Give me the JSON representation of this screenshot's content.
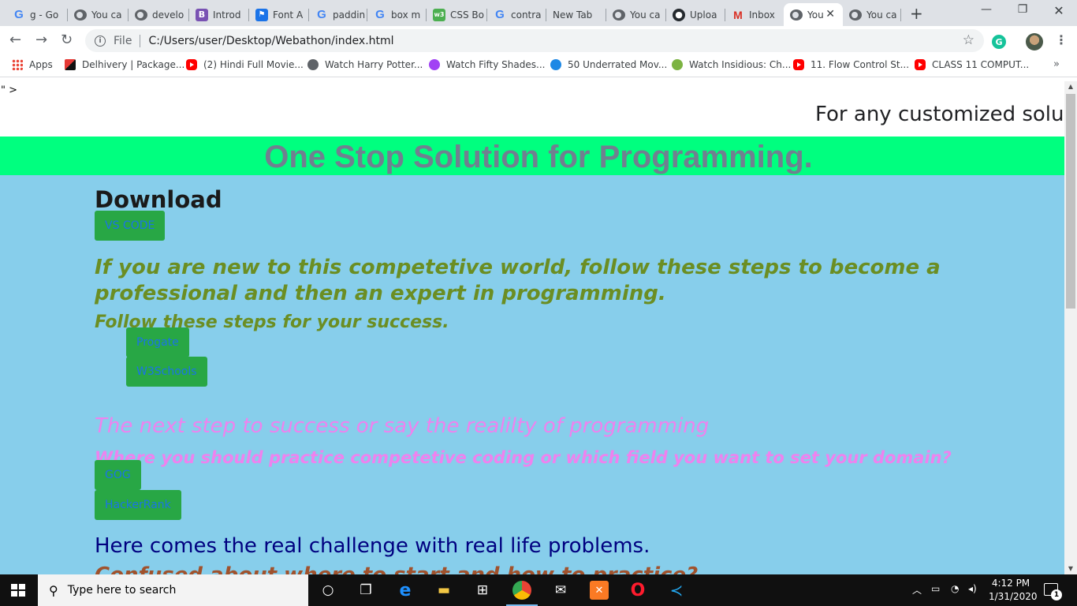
{
  "tabs": [
    {
      "label": "g - Go",
      "icon": "google-icon"
    },
    {
      "label": "You ca",
      "icon": "globe-icon"
    },
    {
      "label": "develo",
      "icon": "globe-icon"
    },
    {
      "label": "Introd",
      "icon": "bootstrap-icon"
    },
    {
      "label": "Font A",
      "icon": "flag-icon"
    },
    {
      "label": "paddin",
      "icon": "google-icon"
    },
    {
      "label": "box m",
      "icon": "google-icon"
    },
    {
      "label": "CSS Bo",
      "icon": "w3schools-icon"
    },
    {
      "label": "contra",
      "icon": "google-icon"
    },
    {
      "label": "New Tab",
      "icon": ""
    },
    {
      "label": "You ca",
      "icon": "globe-icon"
    },
    {
      "label": "Uploa",
      "icon": "github-icon"
    },
    {
      "label": "Inbox",
      "icon": "gmail-icon"
    },
    {
      "label": "You",
      "icon": "globe-icon",
      "active": true
    },
    {
      "label": "You ca",
      "icon": "globe-icon"
    }
  ],
  "toolbar": {
    "scheme": "File",
    "url": "C:/Users/user/Desktop/Webathon/index.html",
    "extension_letter": "G"
  },
  "bookmarks": [
    {
      "label": "Apps",
      "icon": "apps-icon"
    },
    {
      "label": "Delhivery | Package...",
      "icon": "delhivery-icon"
    },
    {
      "label": "(2) Hindi Full Movie...",
      "icon": "youtube-icon"
    },
    {
      "label": "Watch Harry Potter...",
      "icon": "globe-icon"
    },
    {
      "label": "Watch Fifty Shades...",
      "icon": "play-icon"
    },
    {
      "label": "50 Underrated Mov...",
      "icon": "sw-icon"
    },
    {
      "label": "Watch Insidious: Ch...",
      "icon": "play-icon"
    },
    {
      "label": "11. Flow Control St...",
      "icon": "youtube-icon"
    },
    {
      "label": "CLASS 11 COMPUT...",
      "icon": "youtube-icon"
    }
  ],
  "page": {
    "stray_text": "\" >",
    "marquee": "For any customized solut",
    "banner_title": "One Stop Solution for Programming.",
    "download_heading": "Download",
    "vscode_button": "VS CODE",
    "intro_text": "If you are new to this competetive world, follow these steps to become a professional and then an expert in programming.",
    "steps_text": "Follow these steps for your success.",
    "progate_button": "Progate",
    "w3schools_button": "W3Schools",
    "next_step_text": "The next step to success or say the realilty of programming",
    "where_text": "Where you should practice competetive coding or which field you want to set your domain?",
    "gog_button": "GOG",
    "hackerrank_button": "HackerRank",
    "real_challenge_text": "Here comes the real challenge with real life problems.",
    "cutoff_text": "Confused about where to start and how to practice?"
  },
  "taskbar": {
    "search_placeholder": "Type here to search",
    "time": "4:12 PM",
    "date": "1/31/2020",
    "notification_count": "1"
  }
}
